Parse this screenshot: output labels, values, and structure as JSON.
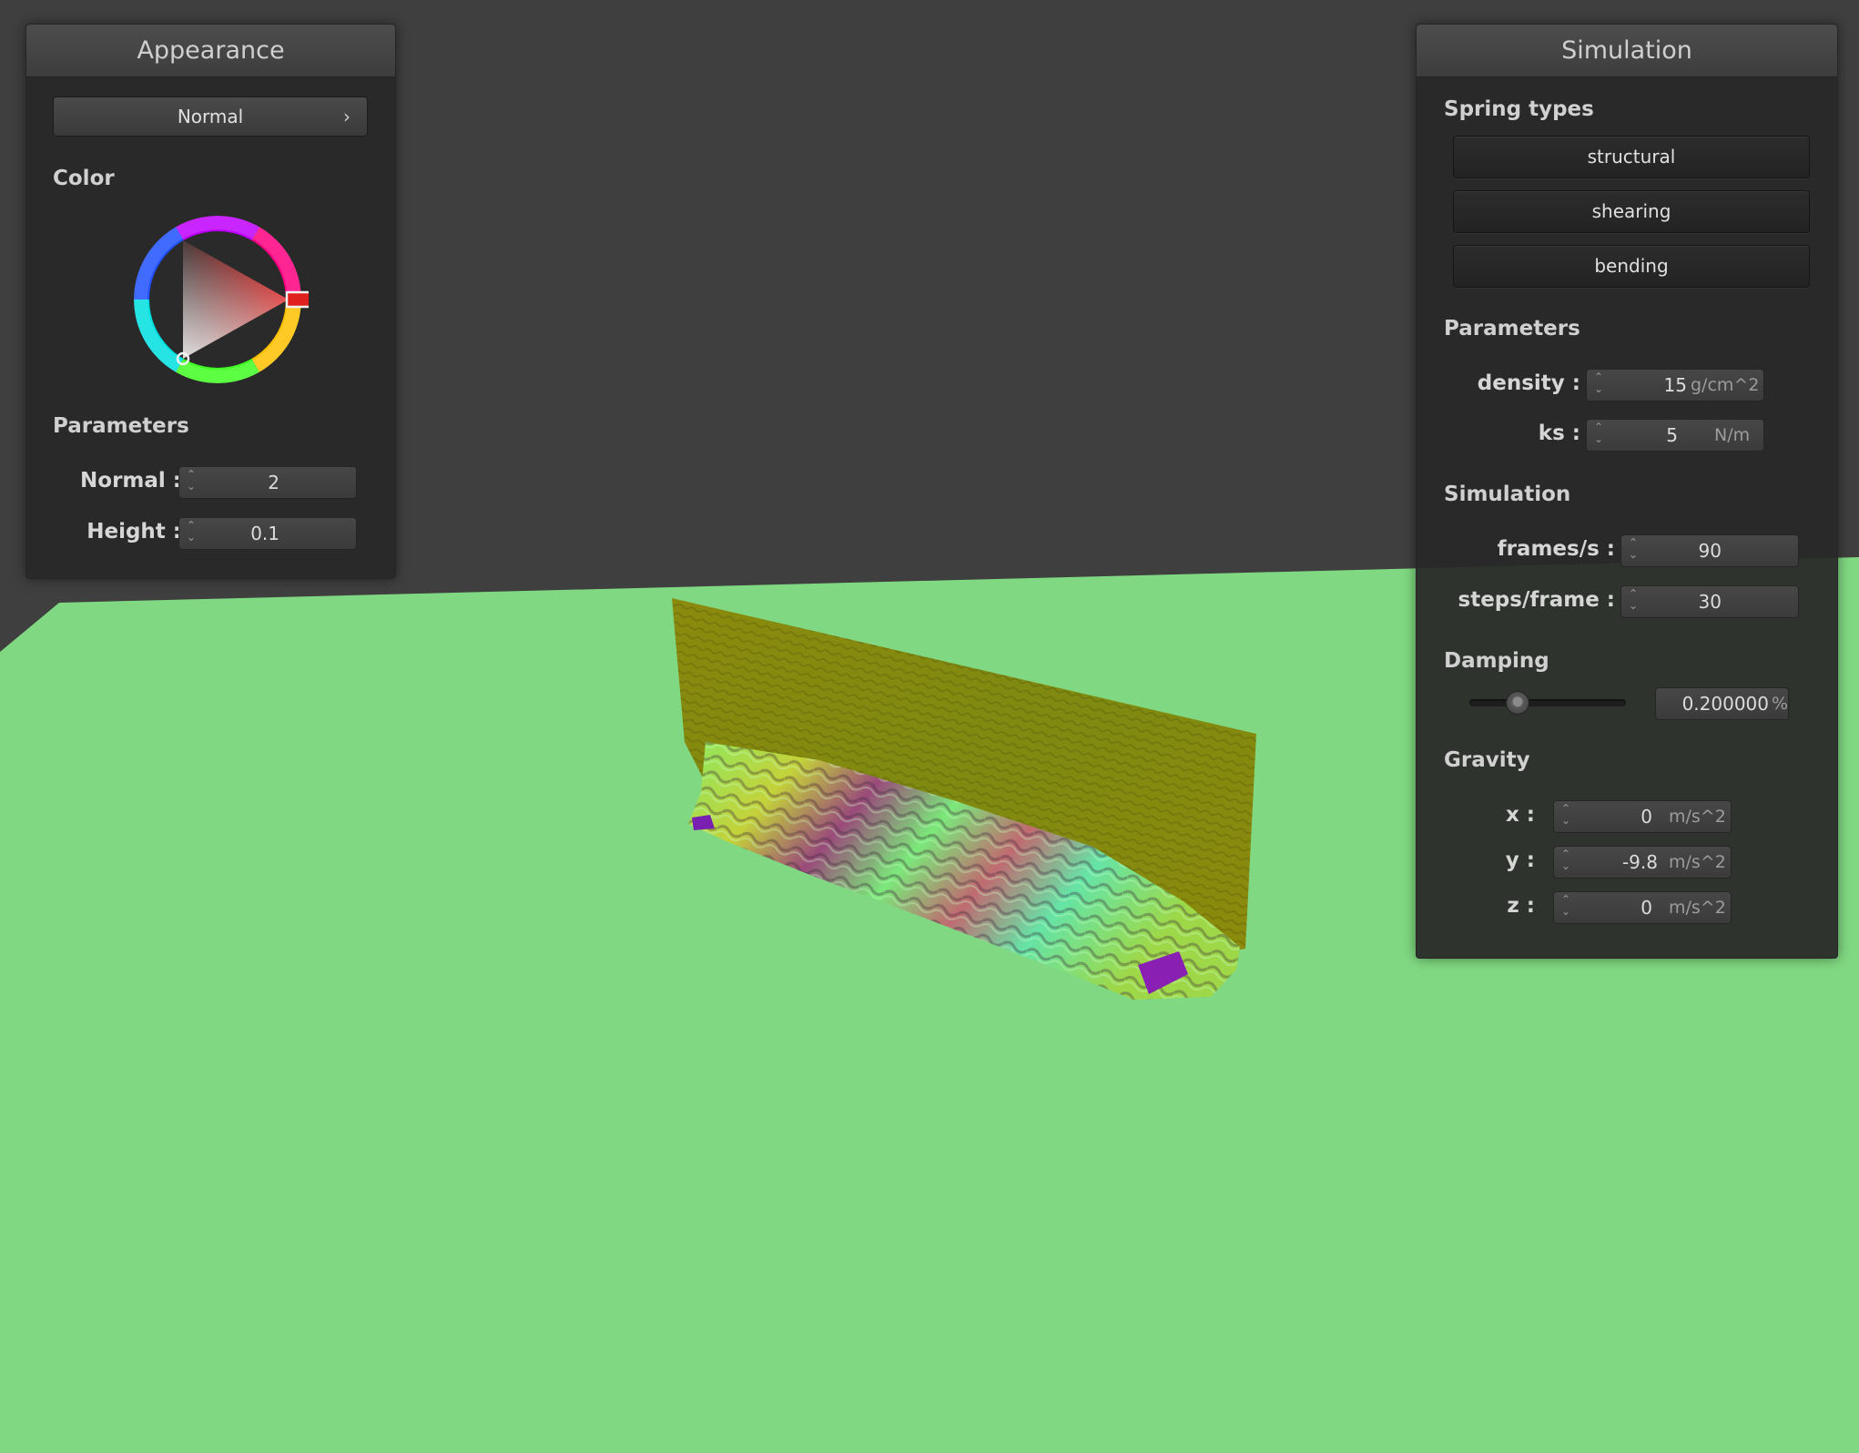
{
  "appearance": {
    "title": "Appearance",
    "shader_button": "Normal",
    "chevron": "›",
    "color_label": "Color",
    "parameters_label": "Parameters",
    "normal_label": "Normal :",
    "normal_value": "2",
    "height_label": "Height :",
    "height_value": "0.1",
    "selected_color": "#e0201e"
  },
  "simulation": {
    "title": "Simulation",
    "spring_types_label": "Spring types",
    "spring_buttons": [
      "structural",
      "shearing",
      "bending"
    ],
    "parameters_label": "Parameters",
    "density_label": "density :",
    "density_value": "15",
    "density_unit": "g/cm^2",
    "ks_label": "ks :",
    "ks_value": "5",
    "ks_unit": "N/m",
    "simulation_label": "Simulation",
    "fps_label": "frames/s :",
    "fps_value": "90",
    "steps_label": "steps/frame :",
    "steps_value": "30",
    "damping_label": "Damping",
    "damping_value": "0.200000",
    "damping_unit": "%",
    "damping_fraction": 0.2,
    "gravity_label": "Gravity",
    "gx_label": "x :",
    "gx_value": "0",
    "gx_unit": "m/s^2",
    "gy_label": "y :",
    "gy_value": "-9.8",
    "gy_unit": "m/s^2",
    "gz_label": "z :",
    "gz_value": "0",
    "gz_unit": "m/s^2"
  },
  "spin_glyph": "⌃⌄",
  "colors": {
    "background": "#3f3f3f",
    "floor": "#80d982",
    "cloth_flat": "#8f8f0c"
  }
}
